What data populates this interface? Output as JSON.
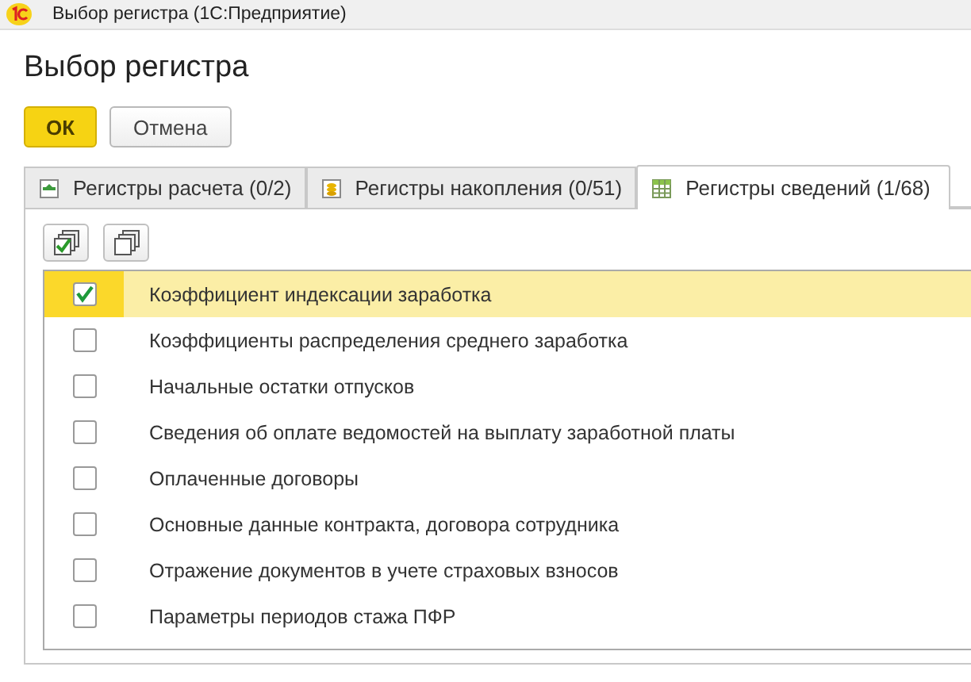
{
  "window": {
    "title": "Выбор регистра  (1С:Предприятие)"
  },
  "heading": "Выбор регистра",
  "buttons": [
    {
      "label": "ОК",
      "kind": "primary"
    },
    {
      "label": "Отмена",
      "kind": "normal"
    }
  ],
  "tabs": [
    {
      "label": "Регистры расчета (0/2)",
      "kind": "calculation",
      "selected": false
    },
    {
      "label": "Регистры накопления (0/51)",
      "kind": "accumulation",
      "selected": false
    },
    {
      "label": "Регистры сведений (1/68)",
      "kind": "information",
      "selected": true
    }
  ],
  "rows": [
    {
      "name": "Коэффициент индексации заработка",
      "checked": true,
      "selected": true
    },
    {
      "name": "Коэффициенты распределения среднего заработка",
      "checked": false,
      "selected": false
    },
    {
      "name": "Начальные остатки отпусков",
      "checked": false,
      "selected": false
    },
    {
      "name": "Сведения об оплате ведомостей на выплату заработной платы",
      "checked": false,
      "selected": false
    },
    {
      "name": "Оплаченные договоры",
      "checked": false,
      "selected": false
    },
    {
      "name": "Основные данные контракта, договора сотрудника",
      "checked": false,
      "selected": false
    },
    {
      "name": "Отражение документов в учете страховых взносов",
      "checked": false,
      "selected": false
    },
    {
      "name": "Параметры периодов стажа ПФР",
      "checked": false,
      "selected": false
    }
  ]
}
